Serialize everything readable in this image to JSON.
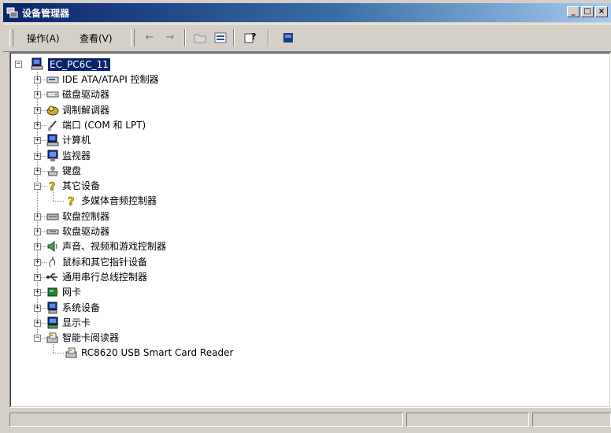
{
  "window": {
    "title": "设备管理器",
    "buttons": {
      "minimize": "_",
      "maximize": "□",
      "close": "×"
    }
  },
  "menu": {
    "action": "操作(A)",
    "view": "查看(V)"
  },
  "toolbar": {
    "icons": [
      "back-arrow-icon",
      "forward-arrow-icon",
      "folder-icon",
      "properties-icon",
      "help-icon",
      "view-icon"
    ],
    "back": "←",
    "forward": "→"
  },
  "tree": {
    "root": {
      "label": "EC_PC6C_11"
    },
    "items": [
      {
        "label": "IDE ATA/ATAPI 控制器",
        "icon": "ide-controller-icon",
        "expanded": false
      },
      {
        "label": "磁盘驱动器",
        "icon": "disk-drive-icon",
        "expanded": false
      },
      {
        "label": "调制解调器",
        "icon": "modem-icon",
        "expanded": false
      },
      {
        "label": "端口 (COM 和 LPT)",
        "icon": "port-icon",
        "expanded": false
      },
      {
        "label": "计算机",
        "icon": "computer-icon",
        "expanded": false
      },
      {
        "label": "监视器",
        "icon": "monitor-icon",
        "expanded": false
      },
      {
        "label": "键盘",
        "icon": "keyboard-icon",
        "expanded": false
      },
      {
        "label": "其它设备",
        "icon": "unknown-device-icon",
        "expanded": true,
        "children": [
          {
            "label": "多媒体音频控制器",
            "icon": "unknown-device-icon"
          }
        ]
      },
      {
        "label": "软盘控制器",
        "icon": "floppy-controller-icon",
        "expanded": false
      },
      {
        "label": "软盘驱动器",
        "icon": "floppy-drive-icon",
        "expanded": false
      },
      {
        "label": "声音、视频和游戏控制器",
        "icon": "sound-icon",
        "expanded": false
      },
      {
        "label": "鼠标和其它指针设备",
        "icon": "mouse-icon",
        "expanded": false
      },
      {
        "label": "通用串行总线控制器",
        "icon": "usb-icon",
        "expanded": false
      },
      {
        "label": "网卡",
        "icon": "network-card-icon",
        "expanded": false
      },
      {
        "label": "系统设备",
        "icon": "system-device-icon",
        "expanded": false
      },
      {
        "label": "显示卡",
        "icon": "display-adapter-icon",
        "expanded": false
      },
      {
        "label": "智能卡阅读器",
        "icon": "smart-card-reader-icon",
        "expanded": true,
        "children": [
          {
            "label": "RC8620 USB Smart Card Reader",
            "icon": "smart-card-reader-icon"
          }
        ]
      }
    ]
  },
  "expander": {
    "collapsed": "+",
    "expanded": "−"
  },
  "colors": {
    "titlebar": "#0a246a",
    "face": "#d4d0c8",
    "selection": "#0a246a"
  }
}
